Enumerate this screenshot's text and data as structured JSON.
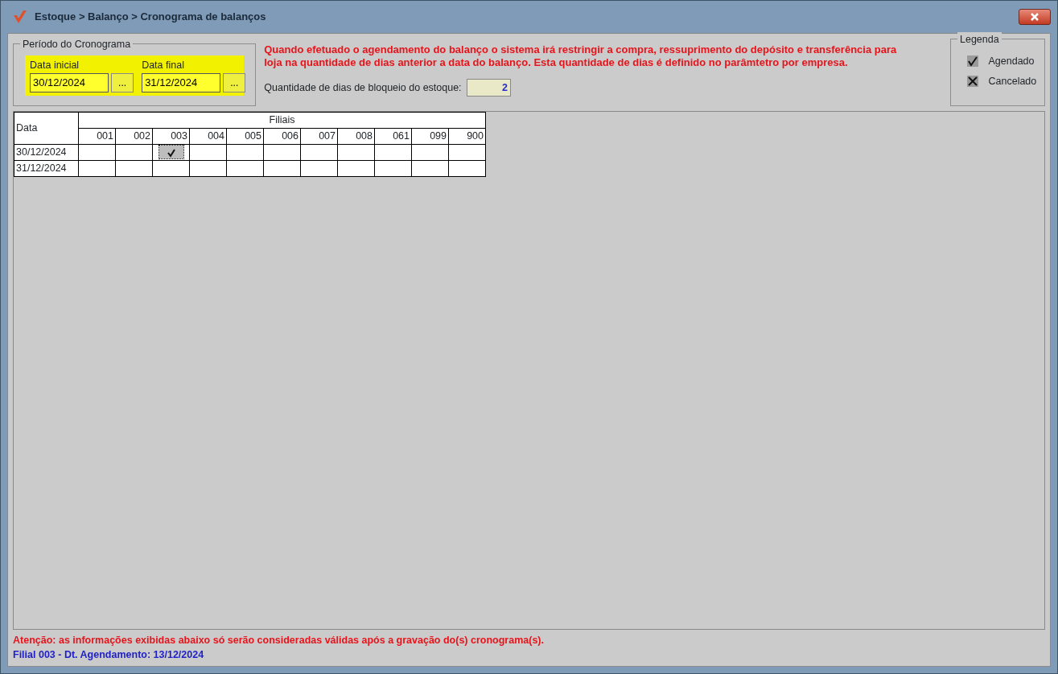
{
  "window": {
    "title": "Estoque > Balanço > Cronograma de balanços"
  },
  "period": {
    "legend": "Período do Cronograma",
    "start_label": "Data inicial",
    "start_value": "30/12/2024",
    "end_label": "Data final",
    "end_value": "31/12/2024",
    "picker_label": "..."
  },
  "notice": "Quando efetuado o agendamento do balanço o sistema irá restringir a compra, ressuprimento do depósito e transferência para loja na quantidade de dias anterior a data do balanço. Esta quantidade de dias é definido no parâmtetro por empresa.",
  "block_days": {
    "label": "Quantidade de dias de bloqueio do estoque:",
    "value": "2"
  },
  "legend": {
    "title": "Legenda",
    "items": [
      {
        "kind": "scheduled",
        "label": "Agendado"
      },
      {
        "kind": "cancelled",
        "label": "Cancelado"
      }
    ]
  },
  "grid": {
    "date_header": "Data",
    "group_header": "Filiais",
    "branches": [
      "001",
      "002",
      "003",
      "004",
      "005",
      "006",
      "007",
      "008",
      "061",
      "099",
      "900"
    ],
    "rows": [
      {
        "date": "30/12/2024",
        "cells": [
          {
            "checked": false
          },
          {
            "checked": false
          },
          {
            "checked": true
          },
          {
            "checked": false
          },
          {
            "checked": false
          },
          {
            "checked": false
          },
          {
            "checked": false
          },
          {
            "checked": false
          },
          {
            "checked": false
          },
          {
            "checked": false
          },
          {
            "checked": false
          }
        ]
      },
      {
        "date": "31/12/2024",
        "cells": [
          {
            "checked": false
          },
          {
            "checked": false
          },
          {
            "checked": false
          },
          {
            "checked": false
          },
          {
            "checked": false
          },
          {
            "checked": false
          },
          {
            "checked": false
          },
          {
            "checked": false
          },
          {
            "checked": false
          },
          {
            "checked": false
          },
          {
            "checked": false
          }
        ]
      }
    ]
  },
  "footer": {
    "warning": "Atenção: as informações exibidas abaixo só serão consideradas válidas após a gravação do(s) cronograma(s).",
    "info": "Filial 003 - Dt. Agendamento: 13/12/2024"
  }
}
